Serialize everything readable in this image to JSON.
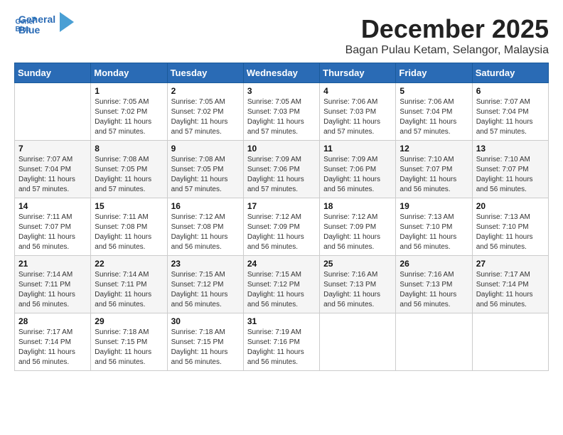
{
  "logo": {
    "line1": "General",
    "line2": "Blue"
  },
  "title": "December 2025",
  "subtitle": "Bagan Pulau Ketam, Selangor, Malaysia",
  "weekdays": [
    "Sunday",
    "Monday",
    "Tuesday",
    "Wednesday",
    "Thursday",
    "Friday",
    "Saturday"
  ],
  "weeks": [
    [
      {
        "day": "",
        "info": ""
      },
      {
        "day": "1",
        "info": "Sunrise: 7:05 AM\nSunset: 7:02 PM\nDaylight: 11 hours\nand 57 minutes."
      },
      {
        "day": "2",
        "info": "Sunrise: 7:05 AM\nSunset: 7:02 PM\nDaylight: 11 hours\nand 57 minutes."
      },
      {
        "day": "3",
        "info": "Sunrise: 7:05 AM\nSunset: 7:03 PM\nDaylight: 11 hours\nand 57 minutes."
      },
      {
        "day": "4",
        "info": "Sunrise: 7:06 AM\nSunset: 7:03 PM\nDaylight: 11 hours\nand 57 minutes."
      },
      {
        "day": "5",
        "info": "Sunrise: 7:06 AM\nSunset: 7:04 PM\nDaylight: 11 hours\nand 57 minutes."
      },
      {
        "day": "6",
        "info": "Sunrise: 7:07 AM\nSunset: 7:04 PM\nDaylight: 11 hours\nand 57 minutes."
      }
    ],
    [
      {
        "day": "7",
        "info": "Sunrise: 7:07 AM\nSunset: 7:04 PM\nDaylight: 11 hours\nand 57 minutes."
      },
      {
        "day": "8",
        "info": "Sunrise: 7:08 AM\nSunset: 7:05 PM\nDaylight: 11 hours\nand 57 minutes."
      },
      {
        "day": "9",
        "info": "Sunrise: 7:08 AM\nSunset: 7:05 PM\nDaylight: 11 hours\nand 57 minutes."
      },
      {
        "day": "10",
        "info": "Sunrise: 7:09 AM\nSunset: 7:06 PM\nDaylight: 11 hours\nand 57 minutes."
      },
      {
        "day": "11",
        "info": "Sunrise: 7:09 AM\nSunset: 7:06 PM\nDaylight: 11 hours\nand 56 minutes."
      },
      {
        "day": "12",
        "info": "Sunrise: 7:10 AM\nSunset: 7:07 PM\nDaylight: 11 hours\nand 56 minutes."
      },
      {
        "day": "13",
        "info": "Sunrise: 7:10 AM\nSunset: 7:07 PM\nDaylight: 11 hours\nand 56 minutes."
      }
    ],
    [
      {
        "day": "14",
        "info": "Sunrise: 7:11 AM\nSunset: 7:07 PM\nDaylight: 11 hours\nand 56 minutes."
      },
      {
        "day": "15",
        "info": "Sunrise: 7:11 AM\nSunset: 7:08 PM\nDaylight: 11 hours\nand 56 minutes."
      },
      {
        "day": "16",
        "info": "Sunrise: 7:12 AM\nSunset: 7:08 PM\nDaylight: 11 hours\nand 56 minutes."
      },
      {
        "day": "17",
        "info": "Sunrise: 7:12 AM\nSunset: 7:09 PM\nDaylight: 11 hours\nand 56 minutes."
      },
      {
        "day": "18",
        "info": "Sunrise: 7:12 AM\nSunset: 7:09 PM\nDaylight: 11 hours\nand 56 minutes."
      },
      {
        "day": "19",
        "info": "Sunrise: 7:13 AM\nSunset: 7:10 PM\nDaylight: 11 hours\nand 56 minutes."
      },
      {
        "day": "20",
        "info": "Sunrise: 7:13 AM\nSunset: 7:10 PM\nDaylight: 11 hours\nand 56 minutes."
      }
    ],
    [
      {
        "day": "21",
        "info": "Sunrise: 7:14 AM\nSunset: 7:11 PM\nDaylight: 11 hours\nand 56 minutes."
      },
      {
        "day": "22",
        "info": "Sunrise: 7:14 AM\nSunset: 7:11 PM\nDaylight: 11 hours\nand 56 minutes."
      },
      {
        "day": "23",
        "info": "Sunrise: 7:15 AM\nSunset: 7:12 PM\nDaylight: 11 hours\nand 56 minutes."
      },
      {
        "day": "24",
        "info": "Sunrise: 7:15 AM\nSunset: 7:12 PM\nDaylight: 11 hours\nand 56 minutes."
      },
      {
        "day": "25",
        "info": "Sunrise: 7:16 AM\nSunset: 7:13 PM\nDaylight: 11 hours\nand 56 minutes."
      },
      {
        "day": "26",
        "info": "Sunrise: 7:16 AM\nSunset: 7:13 PM\nDaylight: 11 hours\nand 56 minutes."
      },
      {
        "day": "27",
        "info": "Sunrise: 7:17 AM\nSunset: 7:14 PM\nDaylight: 11 hours\nand 56 minutes."
      }
    ],
    [
      {
        "day": "28",
        "info": "Sunrise: 7:17 AM\nSunset: 7:14 PM\nDaylight: 11 hours\nand 56 minutes."
      },
      {
        "day": "29",
        "info": "Sunrise: 7:18 AM\nSunset: 7:15 PM\nDaylight: 11 hours\nand 56 minutes."
      },
      {
        "day": "30",
        "info": "Sunrise: 7:18 AM\nSunset: 7:15 PM\nDaylight: 11 hours\nand 56 minutes."
      },
      {
        "day": "31",
        "info": "Sunrise: 7:19 AM\nSunset: 7:16 PM\nDaylight: 11 hours\nand 56 minutes."
      },
      {
        "day": "",
        "info": ""
      },
      {
        "day": "",
        "info": ""
      },
      {
        "day": "",
        "info": ""
      }
    ]
  ]
}
